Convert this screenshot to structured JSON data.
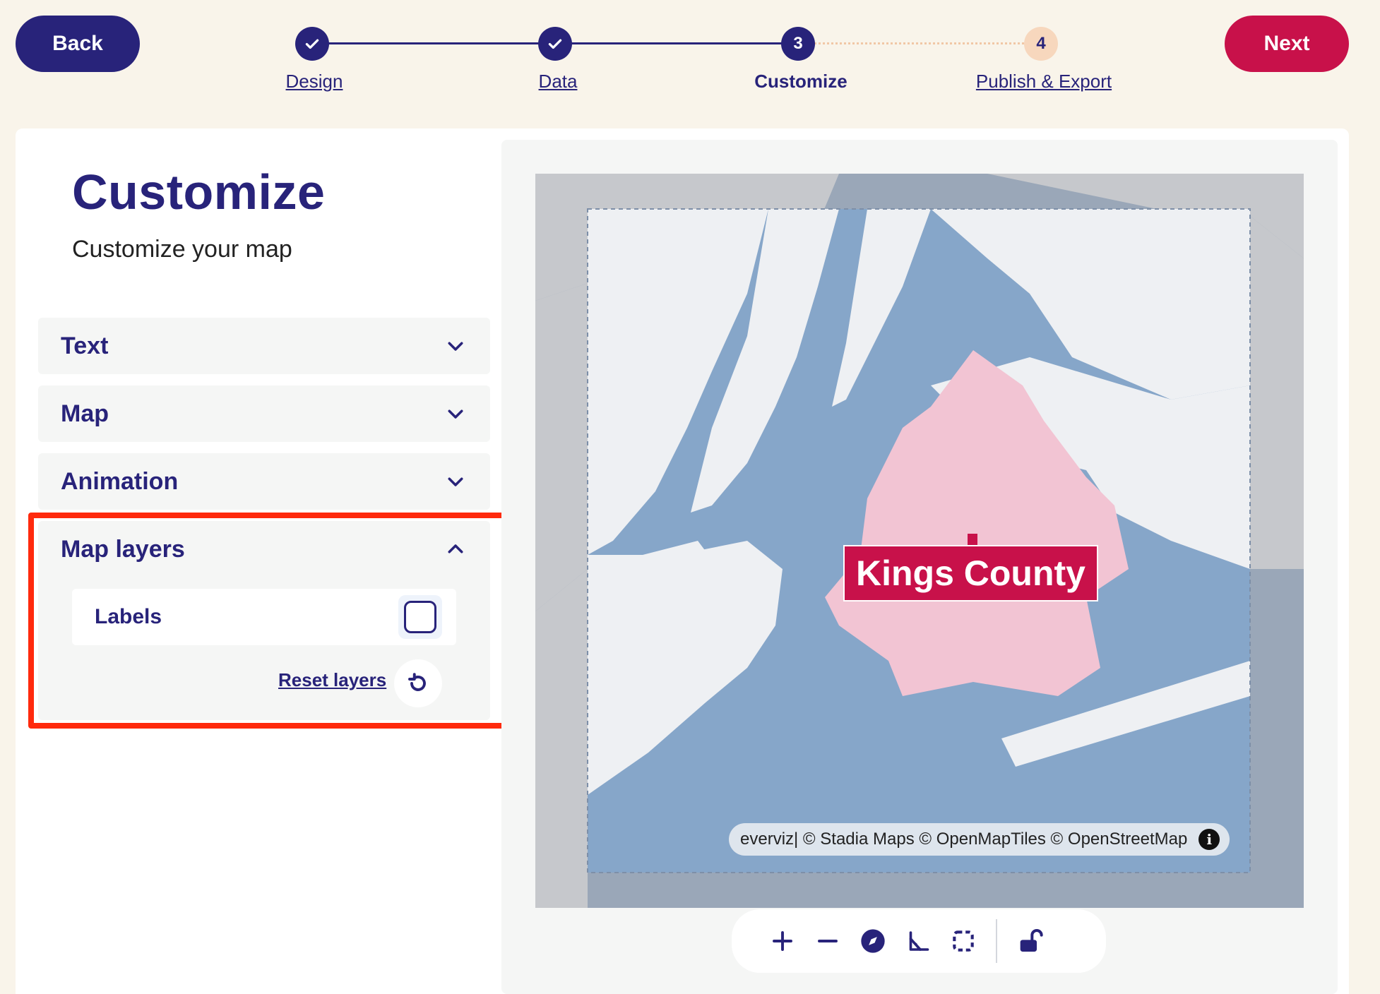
{
  "nav": {
    "back_label": "Back",
    "next_label": "Next"
  },
  "stepper": {
    "steps": [
      {
        "number": "1",
        "label": "Design",
        "state": "done"
      },
      {
        "number": "2",
        "label": "Data",
        "state": "done"
      },
      {
        "number": "3",
        "label": "Customize",
        "state": "current"
      },
      {
        "number": "4",
        "label": "Publish & Export",
        "state": "pending"
      }
    ]
  },
  "panel": {
    "title": "Customize",
    "subtitle": "Customize your map",
    "sections": [
      {
        "label": "Text",
        "expanded": false
      },
      {
        "label": "Map",
        "expanded": false
      },
      {
        "label": "Animation",
        "expanded": false
      },
      {
        "label": "Map layers",
        "expanded": true
      }
    ],
    "map_layers": {
      "labels_option": "Labels",
      "labels_checked": false,
      "reset_label": "Reset layers"
    }
  },
  "map": {
    "region_label": "Kings County",
    "attribution_brand": "everviz",
    "attribution_rest": " | © Stadia Maps © OpenMapTiles © OpenStreetMap",
    "info_icon": "i"
  },
  "colors": {
    "primary": "#28237a",
    "accent": "#c8114a",
    "background": "#f9f4ea",
    "water": "#86a6c9",
    "land": "#eef0f3",
    "region_fill": "#f2c4d3",
    "highlight": "#ff2a0d"
  },
  "icons": {
    "check": "check-icon",
    "chevron_down": "chevron-down-icon",
    "chevron_up": "chevron-up-icon",
    "reset": "reset-icon",
    "zoom_in": "plus-icon",
    "zoom_out": "minus-icon",
    "compass": "compass-icon",
    "angle": "angle-icon",
    "fit_bounds": "fit-bounds-icon",
    "lock": "unlock-icon"
  }
}
